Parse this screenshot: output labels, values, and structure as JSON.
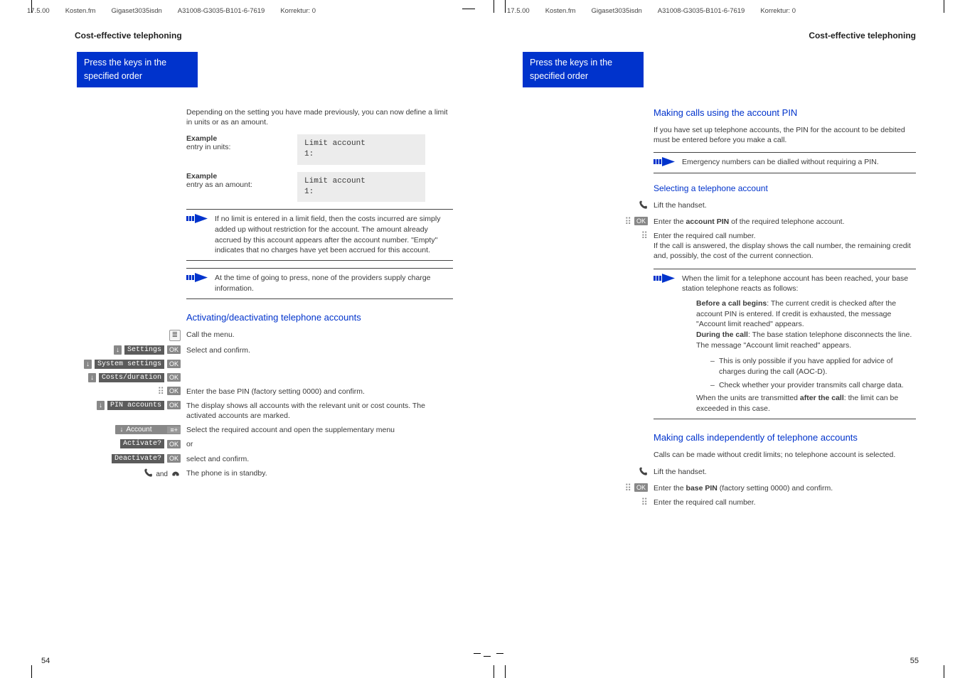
{
  "runhead": {
    "date": "17.5.00",
    "file": "Kosten.fm",
    "product": "Gigaset3035isdn",
    "docnum": "A31008-G3035-B101-6-7619",
    "korrektur": "Korrektur: 0"
  },
  "banner": "Press the keys in the specified order",
  "left": {
    "section": "Cost-effective telephoning",
    "intro": "Depending on the setting you have made previously, you can now define a limit in units or as an amount.",
    "ex1_label": "Example",
    "ex1_sub": "entry in units:",
    "ex1_disp_l1": "Limit account",
    "ex1_disp_l2": "1:",
    "ex2_label": "Example",
    "ex2_sub": "entry as an amount:",
    "ex2_disp_l1": "Limit account",
    "ex2_disp_l2": "1:",
    "note1": "If no limit is entered in a limit field, then the costs incurred are simply added up without restriction for the account. The amount already accrued by this account appears after the account number. \"Empty\" indicates that no charges have yet been accrued for this account.",
    "note2": "At the time of going to press, none of the providers supply charge information.",
    "h1": "Activating/deactivating telephone accounts",
    "steps": {
      "call_menu": "Call the menu.",
      "settings": "Settings",
      "select_confirm": "Select and confirm.",
      "system_settings": "System settings",
      "costs_duration": "Costs/duration",
      "enter_pin": "Enter the base PIN (factory setting 0000) and confirm.",
      "pin_accounts": "PIN accounts",
      "display_accounts": "The display shows all accounts with the relevant unit or cost counts. The activated accounts are marked.",
      "account": "Account",
      "select_req": "Select the required account and open the supplementary menu",
      "activate": "Activate?",
      "or": "or",
      "deactivate": "Deactivate?",
      "sel_conf2": "select and confirm.",
      "standby": "The phone is in standby.",
      "and": "and"
    },
    "pagenum": "54"
  },
  "right": {
    "section": "Cost-effective telephoning",
    "h1": "Making calls using the account PIN",
    "p1": "If you have set up telephone accounts, the PIN for the account to be debited must be entered before you make a call.",
    "note1": "Emergency numbers can be dialled without requiring a PIN.",
    "h2": "Selecting a telephone account",
    "lift": "Lift the handset.",
    "enter_pin_pre": "Enter the ",
    "enter_pin_bold": "account PIN",
    "enter_pin_post": " of the required telephone account.",
    "enter_call": "Enter the required call number.",
    "enter_call2": "If the call is answered, the display shows the call number, the remaining credit and, possibly, the cost of the current connection.",
    "note2_lead": "When the limit for a telephone account has been reached, your base station telephone reacts as follows:",
    "note2_before_b": "Before a call begins",
    "note2_before": ": The current credit is checked after the account PIN is entered. If credit is exhausted, the message \"Account limit reached\" appears.",
    "note2_during_b": "During the call",
    "note2_during": ": The base station telephone disconnects the line. The message \"Account limit reached\" appears.",
    "note2_li1": "This is only possible if you have applied for advice of charges during the call (AOC-D).",
    "note2_li2": "Check whether your provider transmits call charge data.",
    "note2_after_pre": "When the units are transmitted ",
    "note2_after_b": "after the call",
    "note2_after_post": ": the limit can be exceeded in this case.",
    "h3": "Making calls independently of telephone accounts",
    "p3": "Calls can be made without credit limits; no telephone account is selected.",
    "lift2": "Lift the handset.",
    "base_pin_pre": "Enter the ",
    "base_pin_b": "base PIN",
    "base_pin_post": " (factory setting 0000) and confirm.",
    "enter_req": "Enter the required call number.",
    "pagenum": "55",
    "ok": "OK"
  }
}
